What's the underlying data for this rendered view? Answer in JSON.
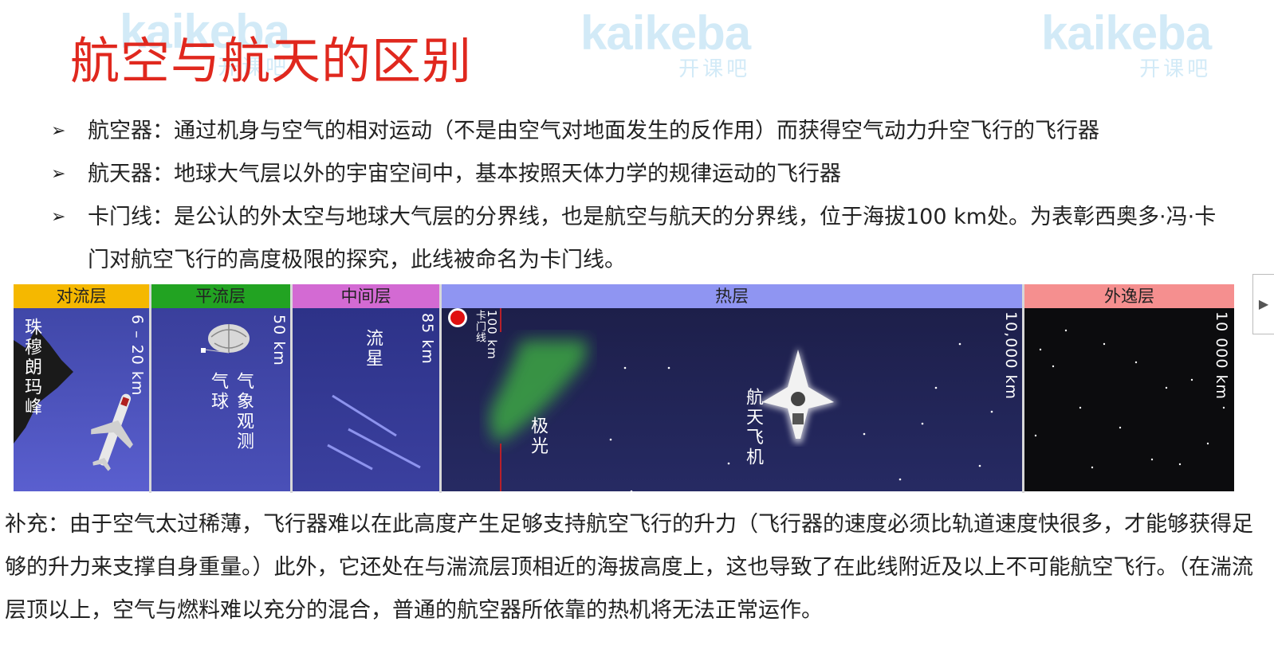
{
  "watermark": {
    "logo": "kaikeba",
    "subtitle": "开课吧"
  },
  "title": "航空与航天的区别",
  "bullets": [
    "航空器：通过机身与空气的相对运动（不是由空气对地面发生的反作用）而获得空气动力升空飞行的飞行器",
    "航天器：地球大气层以外的宇宙空间中，基本按照天体力学的规律运动的飞行器",
    "卡门线：是公认的外太空与地球大气层的分界线，也是航空与航天的分界线，位于海拔100 km处。为表彰西奥多·冯·卡门对航空飞行的高度极限的探究，此线被命名为卡门线。"
  ],
  "diagram": {
    "layers": [
      {
        "name": "对流层",
        "color": "#f5b800"
      },
      {
        "name": "平流层",
        "color": "#22a322"
      },
      {
        "name": "中间层",
        "color": "#d36ad3"
      },
      {
        "name": "热层",
        "color": "#8f95f2"
      },
      {
        "name": "外逸层",
        "color": "#f58f8f"
      }
    ],
    "labels": {
      "everest": "珠穆朗玛峰",
      "troposphere_alt": "6 – 20 km",
      "balloon": "气象观测气球",
      "stratosphere_alt": "50 km",
      "meteor": "流星",
      "mesosphere_alt": "85 km",
      "karman_alt": "100 km",
      "karman_line": "卡门线",
      "aurora": "极光",
      "shuttle": "航天飞机",
      "thermosphere_alt": "10,000 km",
      "exosphere_alt": "10 000 km"
    }
  },
  "note": "补充：由于空气太过稀薄，飞行器难以在此高度产生足够支持航空飞行的升力（飞行器的速度必须比轨道速度快很多，才能够获得足够的升力来支撑自身重量。）此外，它还处在与湍流层顶相近的海拔高度上，这也导致了在此线附近及以上不可能航空飞行。（在湍流层顶以上，空气与燃料难以充分的混合，普通的航空器所依靠的热机将无法正常运作。",
  "nav": {
    "next_icon": "play-icon"
  }
}
